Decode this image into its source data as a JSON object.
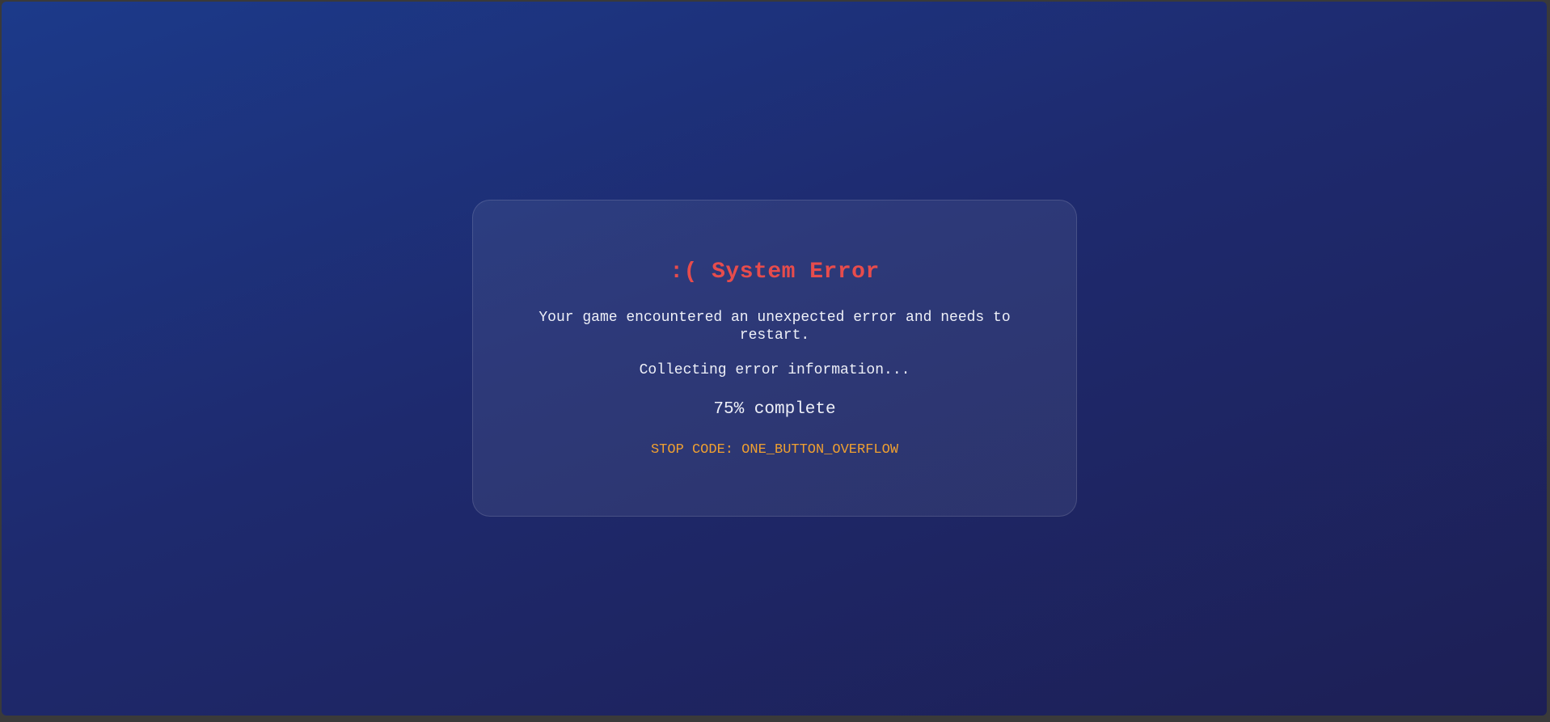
{
  "error": {
    "title": ":( System Error",
    "message": "Your game encountered an unexpected error and needs to restart.",
    "status": "Collecting error information...",
    "progress_label": "75% complete",
    "progress_percent": 75,
    "stop_code": "STOP CODE: ONE_BUTTON_OVERFLOW"
  },
  "colors": {
    "title": "#e74c4c",
    "stop_code": "#f0a030",
    "text": "#eef0f8",
    "background_start": "#1c3a8a",
    "background_end": "#1d1f55"
  }
}
